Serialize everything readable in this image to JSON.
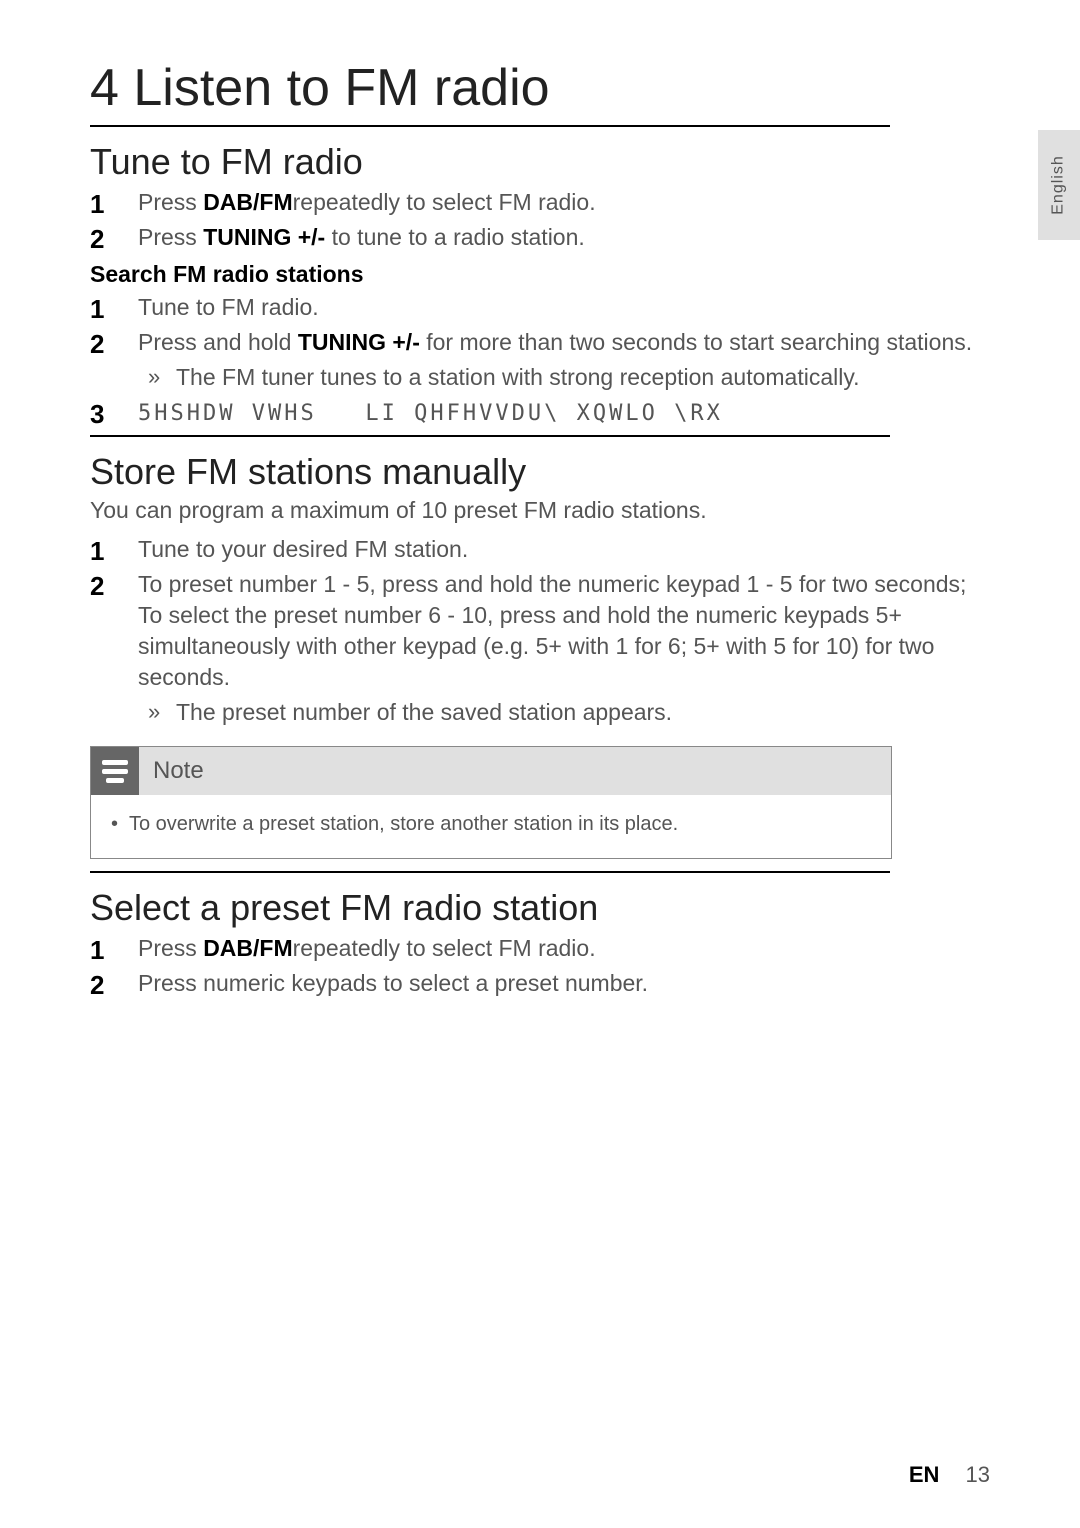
{
  "side_tab": "English",
  "chapter_title": "4   Listen to FM radio",
  "section1": {
    "title": "Tune to FM radio",
    "steps": [
      {
        "pre": "Press ",
        "bold": "DAB/FM",
        "post": "repeatedly to select FM radio."
      },
      {
        "pre": "Press ",
        "bold": "TUNING +/-",
        "post": " to tune to a radio station."
      }
    ],
    "sub_heading": "Search FM radio stations",
    "search_steps": [
      {
        "text": "Tune to FM radio."
      },
      {
        "pre": "Press and hold ",
        "bold": "TUNING +/-",
        "post": " for more than two seconds to start searching stations.",
        "result": "The FM tuner tunes to a station with strong reception automatically."
      },
      {
        "garbled": "5HSHDW VWHS   LI QHFHVVDU\\ XQWLO \\RX"
      }
    ]
  },
  "section2": {
    "title": "Store FM stations manually",
    "intro": "You can program a maximum of 10 preset FM radio stations.",
    "steps": [
      {
        "text": "Tune to your desired FM station."
      },
      {
        "text": "To preset number 1 - 5, press and hold the numeric keypad 1 - 5 for two seconds;\nTo select the preset number 6 - 10, press and hold the numeric keypads 5+ simultaneously with other keypad (e.g. 5+ with 1 for 6; 5+ with 5 for 10) for two seconds.",
        "result": "The preset number of the saved station appears."
      }
    ]
  },
  "note": {
    "label": "Note",
    "body": "To overwrite a preset station, store another station in its place."
  },
  "section3": {
    "title": "Select a preset FM radio station",
    "steps": [
      {
        "pre": "Press ",
        "bold": "DAB/FM",
        "post": "repeatedly to select FM radio."
      },
      {
        "text": "Press numeric keypads to select a preset number."
      }
    ]
  },
  "footer": {
    "lang": "EN",
    "page": "13"
  }
}
